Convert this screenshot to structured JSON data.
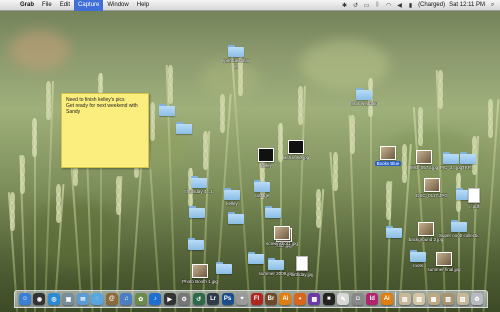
{
  "menubar": {
    "apple_icon": "apple-logo-icon",
    "app_name": "Grab",
    "items": [
      "File",
      "Edit",
      "Capture",
      "Window",
      "Help"
    ],
    "active_item": "Capture",
    "status_icons": [
      "spotlight-icon",
      "time-machine-icon",
      "display-icon",
      "bluetooth-icon",
      "wifi-icon",
      "volume-icon"
    ],
    "battery_text": "(Charged)",
    "clock": "Sat 12:11 PM",
    "search_icon": "search-icon"
  },
  "sticky_note": {
    "line1": "Need to finish kelley's pics",
    "line2": "Get ready for next weekend with Sandy"
  },
  "desktop_items": [
    {
      "id": "riperduesimac",
      "label": "riperduesimac",
      "label2": "es",
      "kind": "folder"
    },
    {
      "id": "feni-wedding",
      "label": "fenis wedding",
      "kind": "folder"
    },
    {
      "id": "folder-left1",
      "label": "",
      "kind": "folder"
    },
    {
      "id": "folder-left2",
      "label": "",
      "kind": "folder"
    },
    {
      "id": "img-black1",
      "label": "kelley",
      "kind": "thumb-dark"
    },
    {
      "id": "img-black2",
      "label": "lash.lifme.jpg",
      "kind": "thumb-dark"
    },
    {
      "id": "thumb-sel",
      "label": "Books Blue",
      "kind": "photo",
      "selected": true
    },
    {
      "id": "pic-r1",
      "label": "PIC_2...jpg",
      "kind": "folder"
    },
    {
      "id": "pic-r2",
      "label": "TKP...",
      "kind": "folder"
    },
    {
      "id": "img-0574",
      "label": "IMG_0574.jpg",
      "kind": "photo"
    },
    {
      "id": "dsc-r",
      "label": "DSC_0117.JPG",
      "kind": "photo"
    },
    {
      "id": "thumbsday",
      "label": "thursday 4...1",
      "kind": "folder"
    },
    {
      "id": "cottage",
      "label": "cottage",
      "kind": "folder"
    },
    {
      "id": "kelley-folder",
      "label": "kelley",
      "kind": "folder"
    },
    {
      "id": "folder-mid1",
      "label": "",
      "kind": "folder"
    },
    {
      "id": "folder-mid2",
      "label": "",
      "kind": "folder"
    },
    {
      "id": "folder-mid3",
      "label": "",
      "kind": "folder"
    },
    {
      "id": "sdfsfs-jpg",
      "label": "sfsz.jpg",
      "kind": "photo"
    },
    {
      "id": "screenshot1",
      "label": "screenshot1 jpg",
      "kind": "photo"
    },
    {
      "id": "summer",
      "label": "summer 2008.jpg",
      "kind": "folder"
    },
    {
      "id": "birthday",
      "label": "birthday.jpg",
      "kind": "doc"
    },
    {
      "id": "background",
      "label": "background 2.jpg",
      "kind": "photo"
    },
    {
      "id": "super-ooot",
      "label": "Super ooot! collection",
      "kind": "folder"
    },
    {
      "id": "folder-r3",
      "label": "",
      "kind": "folder"
    },
    {
      "id": "folder-r4",
      "label": "",
      "kind": "folder"
    },
    {
      "id": "doc-pdf",
      "label": "...pdf",
      "kind": "doc"
    },
    {
      "id": "roots",
      "label": "roots",
      "kind": "folder"
    },
    {
      "id": "summer-final",
      "label": "summer final.jpg",
      "kind": "photo"
    },
    {
      "id": "folder-bl1",
      "label": "",
      "kind": "folder"
    },
    {
      "id": "folder-bl2",
      "label": "",
      "kind": "folder"
    },
    {
      "id": "photo-bl",
      "label": "Photo Booth 1.jpg",
      "kind": "photo"
    },
    {
      "id": "folder-bl3",
      "label": "",
      "kind": "folder"
    }
  ],
  "dock": {
    "apps": [
      {
        "name": "finder-icon",
        "glyph": "☺",
        "color": "#3a7fd6"
      },
      {
        "name": "dashboard-icon",
        "glyph": "◉",
        "color": "#333"
      },
      {
        "name": "safari-icon",
        "glyph": "◎",
        "color": "#2a8ad6"
      },
      {
        "name": "preview-icon",
        "glyph": "▣",
        "color": "#7a8d9b"
      },
      {
        "name": "mail-icon",
        "glyph": "✉",
        "color": "#5b9bd6"
      },
      {
        "name": "ichat-icon",
        "glyph": "◌",
        "color": "#58a6e0"
      },
      {
        "name": "address-book-icon",
        "glyph": "@",
        "color": "#8a6b3c"
      },
      {
        "name": "itunes-icon",
        "glyph": "♫",
        "color": "#4b7fc4"
      },
      {
        "name": "iphoto-icon",
        "glyph": "✿",
        "color": "#6a8b4a"
      },
      {
        "name": "itunes-store-icon",
        "glyph": "♪",
        "color": "#1f6fd0"
      },
      {
        "name": "front-row-icon",
        "glyph": "▶",
        "color": "#333"
      },
      {
        "name": "system-preferences-icon",
        "glyph": "⚙",
        "color": "#777"
      },
      {
        "name": "time-machine-icon",
        "glyph": "↺",
        "color": "#2c6a4a"
      },
      {
        "name": "lightroom-icon",
        "glyph": "Lr",
        "color": "#2e3b4a"
      },
      {
        "name": "photoshop-icon",
        "glyph": "Ps",
        "color": "#1d4d8a"
      },
      {
        "name": "grab-icon",
        "glyph": "⌖",
        "color": "#9a9a9a"
      },
      {
        "name": "flash-icon",
        "glyph": "Fl",
        "color": "#b3261e"
      },
      {
        "name": "bridge-icon",
        "glyph": "Br",
        "color": "#6e4a2a"
      },
      {
        "name": "illustrator-icon",
        "glyph": "Ai",
        "color": "#e07f10"
      },
      {
        "name": "firefox-icon",
        "glyph": "◕",
        "color": "#d9661a"
      },
      {
        "name": "app-purple-icon",
        "glyph": "▩",
        "color": "#6c3aa8"
      },
      {
        "name": "app-dark-icon",
        "glyph": "■",
        "color": "#222"
      },
      {
        "name": "textedit-icon",
        "glyph": "✎",
        "color": "#d8d8d8"
      },
      {
        "name": "app-gray-icon",
        "glyph": "◘",
        "color": "#888"
      },
      {
        "name": "indesign-icon",
        "glyph": "Id",
        "color": "#b0256b"
      },
      {
        "name": "illustrator2-icon",
        "glyph": "Ai",
        "color": "#e07f10"
      },
      {
        "name": "stack-folder-icon",
        "glyph": "▤",
        "color": "#c9b79a"
      },
      {
        "name": "downloads-stack-icon",
        "glyph": "▥",
        "color": "#d4c3a4"
      },
      {
        "name": "documents-stack-icon",
        "glyph": "▦",
        "color": "#bca883"
      },
      {
        "name": "pictures-stack-icon",
        "glyph": "▧",
        "color": "#a89370"
      },
      {
        "name": "apps-stack-icon",
        "glyph": "▨",
        "color": "#c9b79a"
      },
      {
        "name": "trash-icon",
        "glyph": "♻",
        "color": "#b8bcc2"
      }
    ]
  },
  "colors": {
    "menubar_highlight": "#3f6fd6",
    "sticky_yellow": "#fbee7e",
    "folder_blue": "#9cc8ee"
  }
}
